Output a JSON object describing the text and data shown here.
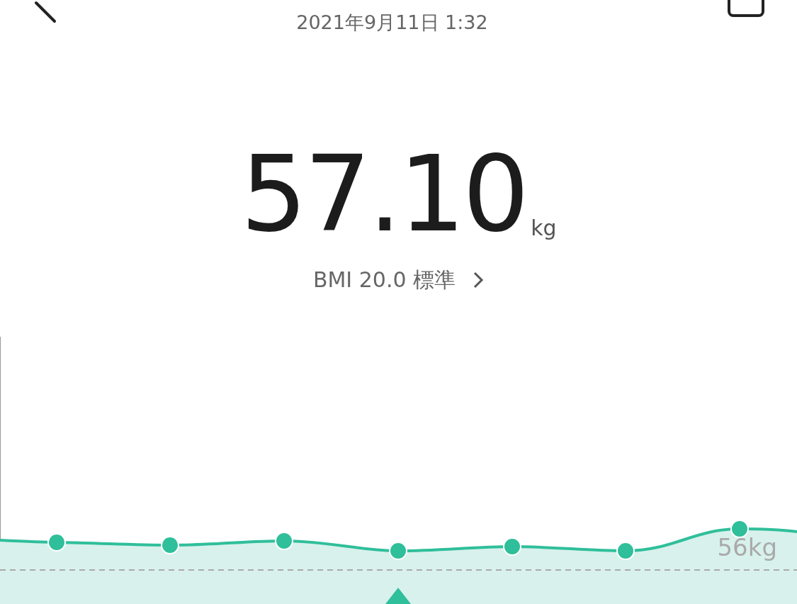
{
  "header": {
    "date": "2021年9月11日 1:32"
  },
  "weight": {
    "value": "57.10",
    "unit": "kg"
  },
  "bmi": {
    "label": "BMI 20.0 標準"
  },
  "chart": {
    "reference_label": "56kg"
  }
}
